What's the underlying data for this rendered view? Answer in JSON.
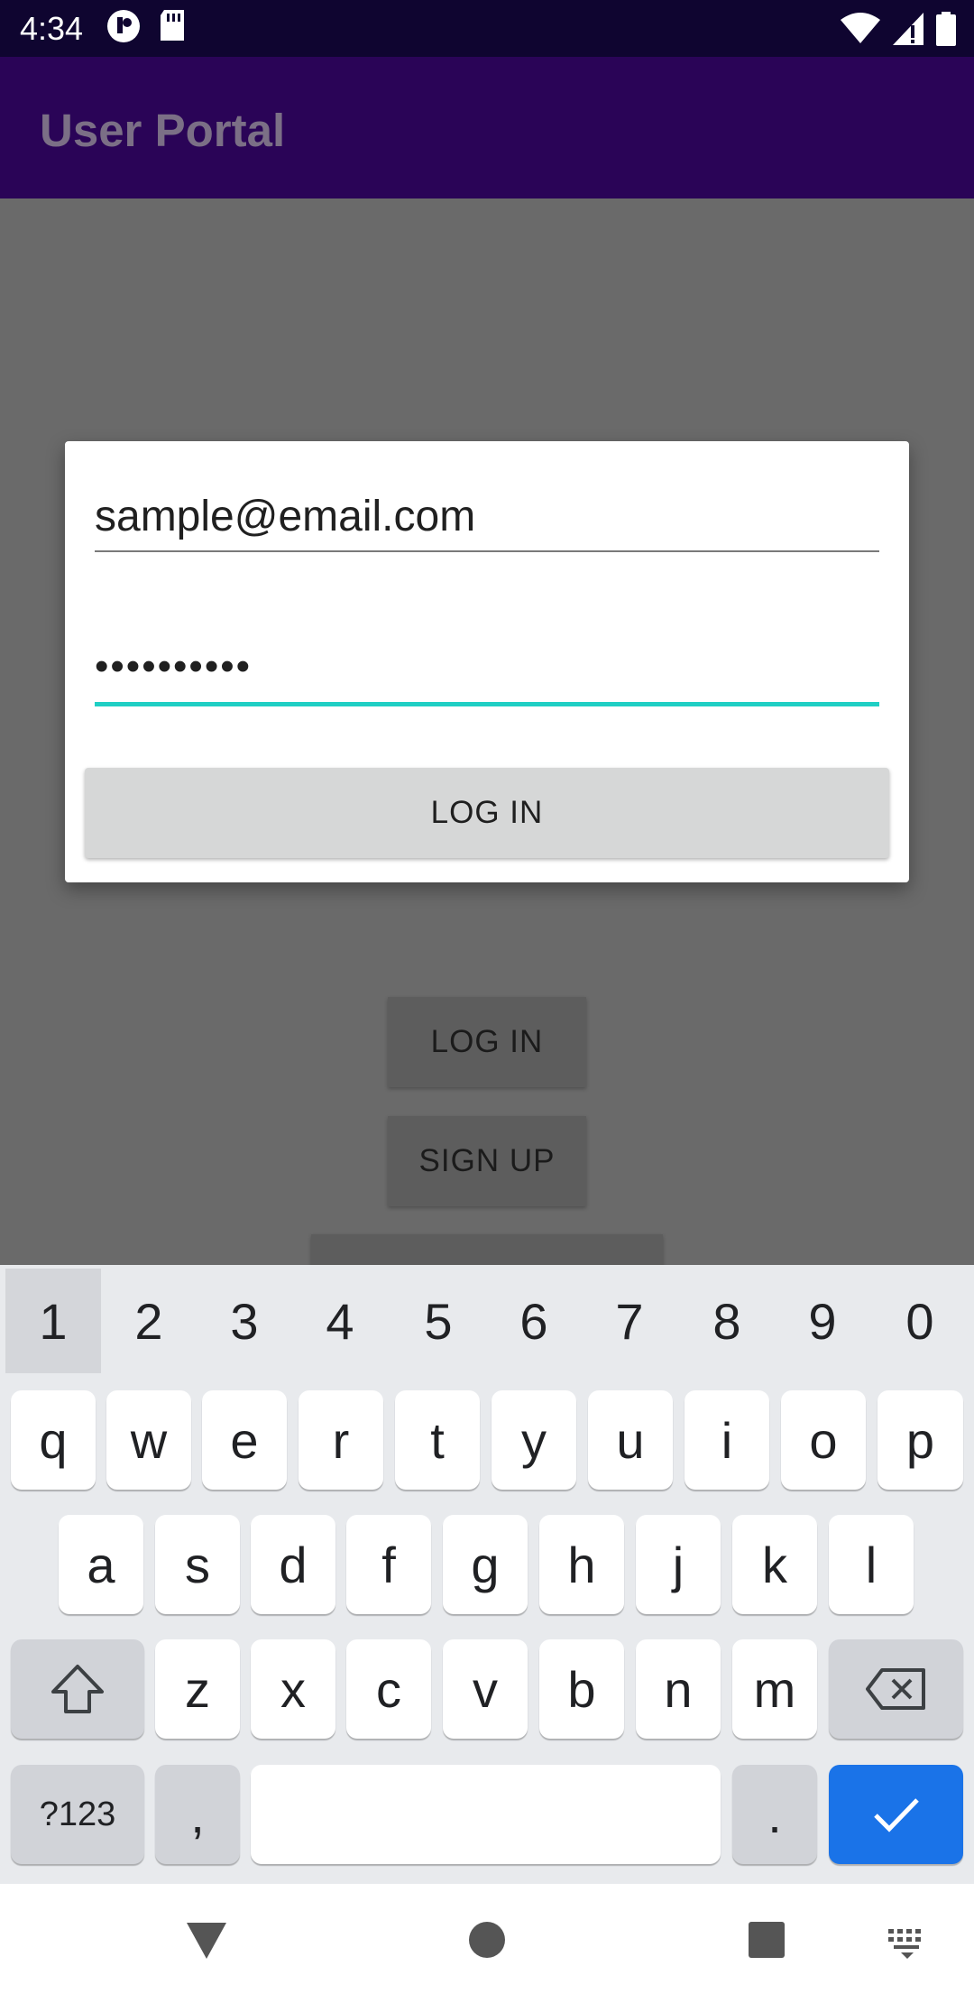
{
  "status_bar": {
    "time": "4:34",
    "icons_left": [
      "notification-app-icon",
      "sd-card-icon"
    ],
    "icons_right": [
      "wifi-icon",
      "cell-signal-icon",
      "battery-icon"
    ]
  },
  "app_bar": {
    "title": "User Portal"
  },
  "background": {
    "login_label": "LOG IN",
    "signup_label": "SIGN UP"
  },
  "dialog": {
    "email_value": "sample@email.com",
    "password_value": "••••••••••",
    "login_label": "LOG IN",
    "accent_color": "#1fcfc4"
  },
  "keyboard": {
    "number_row": [
      "1",
      "2",
      "3",
      "4",
      "5",
      "6",
      "7",
      "8",
      "9",
      "0"
    ],
    "row1": [
      "q",
      "w",
      "e",
      "r",
      "t",
      "y",
      "u",
      "i",
      "o",
      "p"
    ],
    "row2": [
      "a",
      "s",
      "d",
      "f",
      "g",
      "h",
      "j",
      "k",
      "l"
    ],
    "row3": [
      "z",
      "x",
      "c",
      "v",
      "b",
      "n",
      "m"
    ],
    "symbols_label": "?123",
    "comma_label": ",",
    "period_label": ".",
    "enter_color": "#1a73e8"
  },
  "nav_bar": {
    "icons": [
      "back-icon",
      "home-icon",
      "recents-icon",
      "keyboard-switch-icon"
    ]
  }
}
